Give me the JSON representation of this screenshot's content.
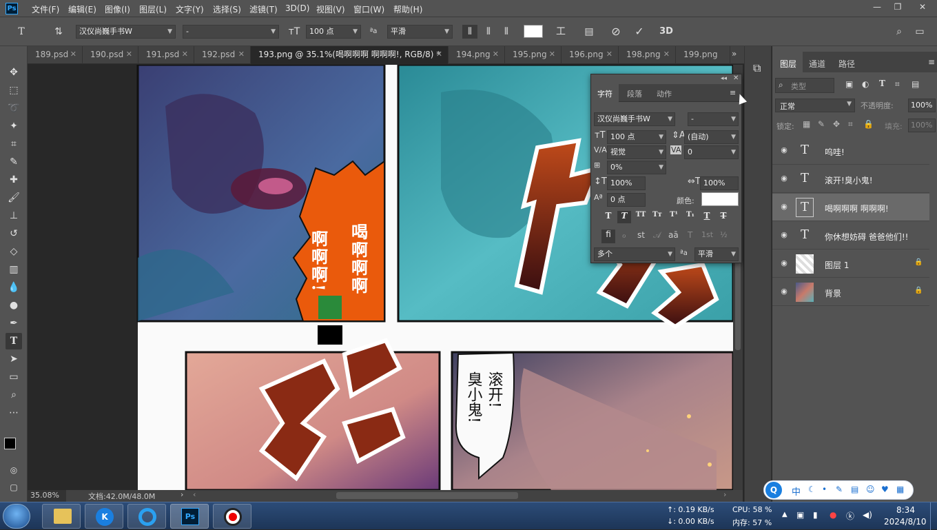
{
  "app": {
    "logo": "Ps"
  },
  "menu": [
    "文件(F)",
    "编辑(E)",
    "图像(I)",
    "图层(L)",
    "文字(Y)",
    "选择(S)",
    "滤镜(T)",
    "3D(D)",
    "视图(V)",
    "窗口(W)",
    "帮助(H)"
  ],
  "options": {
    "font_family": "汉仪尚巍手书W",
    "font_style": "-",
    "font_size": "100 点",
    "antialias": "平滑"
  },
  "tabs": [
    {
      "label": "189.psd"
    },
    {
      "label": "190.psd"
    },
    {
      "label": "191.psd"
    },
    {
      "label": "192.psd"
    },
    {
      "label": "193.png @ 35.1%(喝啊啊啊 啊啊啊!, RGB/8) *"
    },
    {
      "label": "194.png"
    },
    {
      "label": "195.png"
    },
    {
      "label": "196.png"
    },
    {
      "label": "198.png"
    },
    {
      "label": "199.png"
    }
  ],
  "status": {
    "zoom": "35.08%",
    "doc": "文档:42.0M/48.0M"
  },
  "char_panel": {
    "tabs": [
      "字符",
      "段落",
      "动作"
    ],
    "font_family": "汉仪尚巍手书W",
    "font_style": "-",
    "size": "100 点",
    "leading": "(自动)",
    "kerning": "视觉",
    "tracking": "0",
    "scale_percent": "0%",
    "vscale": "100%",
    "hscale": "100%",
    "baseline": "0 点",
    "color_label": "颜色:",
    "language": "多个",
    "antialias": "平滑",
    "color": "#ffffff"
  },
  "layers_panel": {
    "tabs": [
      "图层",
      "通道",
      "路径"
    ],
    "search_placeholder": "类型",
    "blend_mode": "正常",
    "opacity_label": "不透明度:",
    "opacity": "100%",
    "lock_label": "锁定:",
    "fill_label": "填充:",
    "fill": "100%",
    "layers": [
      {
        "name": "呜哇!",
        "type": "text"
      },
      {
        "name": "滚开!臭小鬼!",
        "type": "text"
      },
      {
        "name": "喝啊啊啊 啊啊啊!",
        "type": "text"
      },
      {
        "name": "你休想妨碍 爸爸他们!!",
        "type": "text"
      },
      {
        "name": "图层 1",
        "type": "image"
      },
      {
        "name": "背景",
        "type": "image"
      }
    ]
  },
  "canvas": {
    "bubble_text_right": "喝啊啊啊",
    "bubble_text_left": "啊啊啊!",
    "speech_text_col1": "滚开!",
    "speech_text_col2": "臭小鬼!"
  },
  "ime": {
    "label": "中"
  },
  "taskbar": {
    "net_up": "↑: 0.19 KB/s",
    "net_down": "↓: 0.00 KB/s",
    "cpu": "CPU: 58 %",
    "mem": "内存: 57 %",
    "time": "8:34",
    "date": "2024/8/10"
  }
}
